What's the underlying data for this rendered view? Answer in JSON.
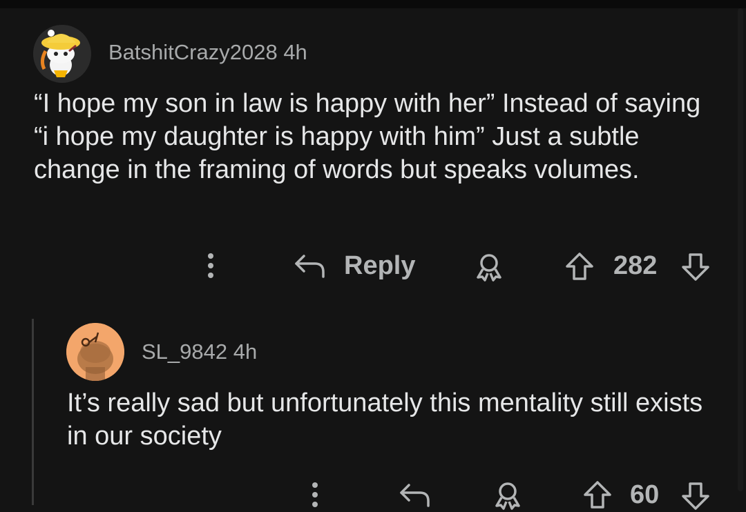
{
  "comments": [
    {
      "author": "BatshitCrazy2028",
      "time": "4h",
      "text": "“I hope my son in law is happy with her” Instead of saying “i hope my daughter is happy with him” Just a subtle change in the framing of words but speaks volumes.",
      "actions": {
        "more_icon": "more-vertical-icon",
        "reply_icon": "reply-arrow-icon",
        "reply_label": "Reply",
        "award_icon": "award-icon",
        "upvote_icon": "upvote-arrow-icon",
        "score": "282",
        "downvote_icon": "downvote-arrow-icon"
      }
    },
    {
      "author": "SL_9842",
      "time": "4h",
      "text": "It’s really sad but unfortunately this mentality still exists in our society",
      "actions": {
        "more_icon": "more-vertical-icon",
        "reply_icon": "reply-arrow-icon",
        "award_icon": "award-icon",
        "upvote_icon": "upvote-arrow-icon",
        "score": "60",
        "downvote_icon": "downvote-arrow-icon"
      }
    }
  ],
  "colors": {
    "background": "#141414",
    "text": "#e6e7e8",
    "muted": "#a8aaab",
    "avatar2_bg": "#f3a66b"
  }
}
